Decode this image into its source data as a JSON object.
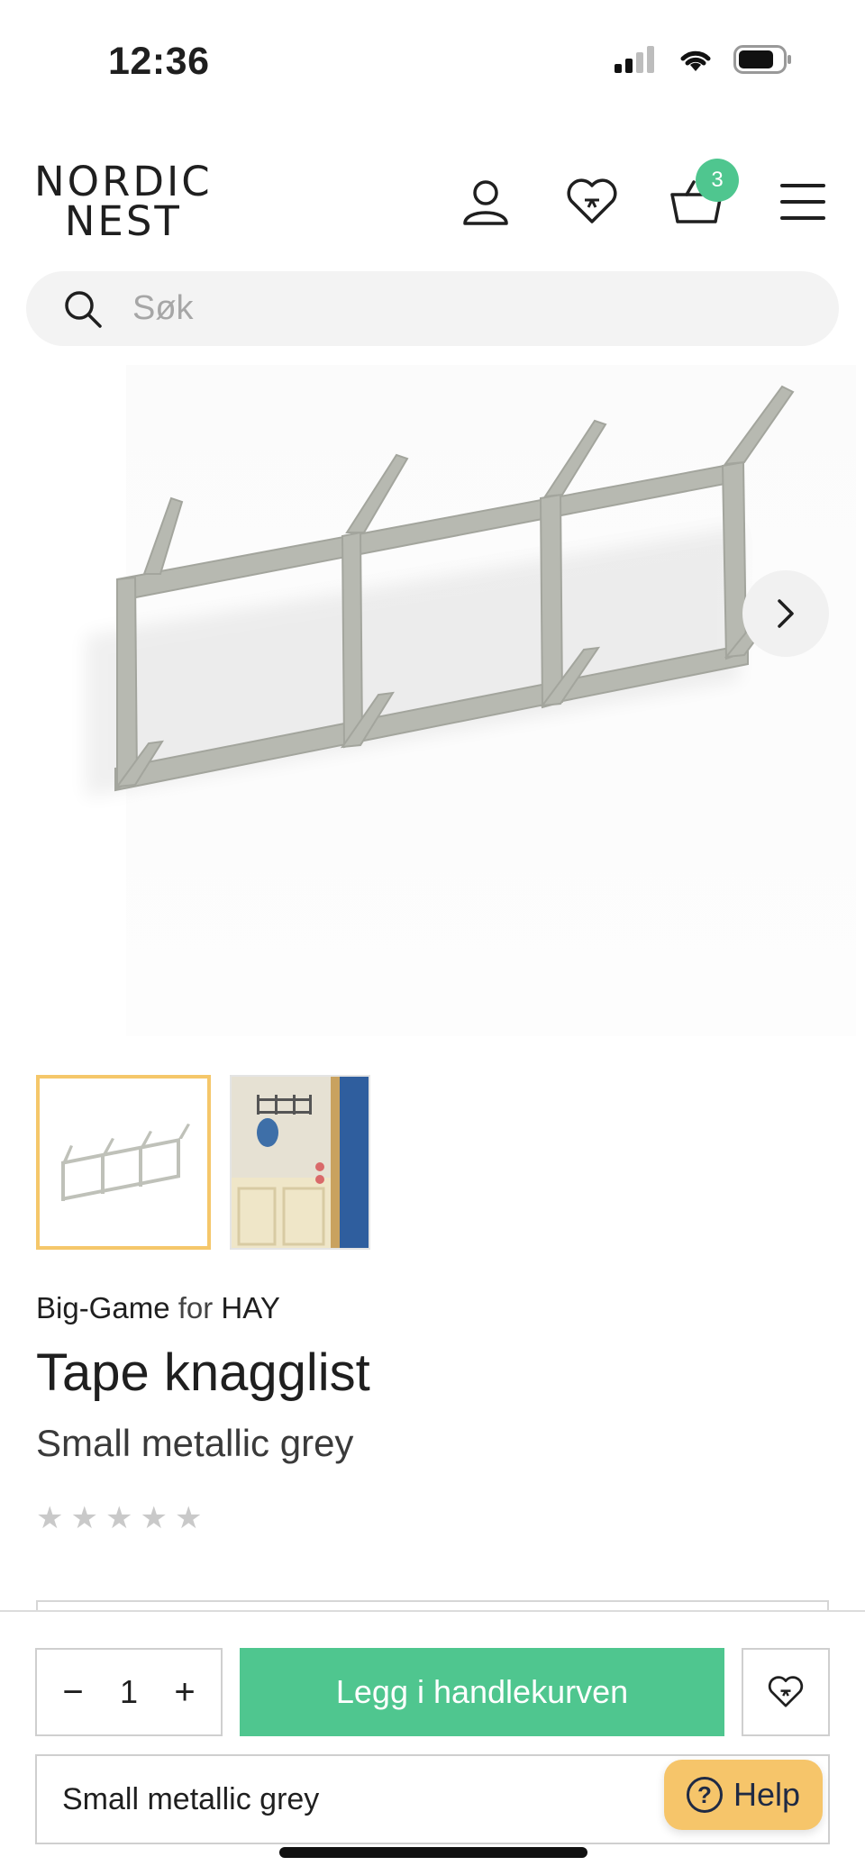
{
  "status_bar": {
    "time": "12:36"
  },
  "header": {
    "logo_line1": "NORDIC",
    "logo_line2": "NEST",
    "cart_count": "3",
    "icons": [
      "user-icon",
      "heart-icon",
      "basket-icon",
      "menu-icon"
    ]
  },
  "search": {
    "placeholder": "Søk"
  },
  "gallery": {
    "thumbnails": 2,
    "selected_index": 0,
    "accent_color": "#f5c76a"
  },
  "product": {
    "designer": "Big-Game",
    "for_word": "for",
    "brand": "HAY",
    "title": "Tape knagglist",
    "variant": "Small metallic grey",
    "rating_stars": 5,
    "rating_value": 0
  },
  "purchase": {
    "qty_minus": "−",
    "qty_value": "1",
    "qty_plus": "+",
    "add_to_cart_label": "Legg i handlekurven",
    "add_to_cart_color": "#4fc68f",
    "selected_variant": "Small metallic grey"
  },
  "help": {
    "label": "Help",
    "icon_glyph": "?",
    "color": "#f6c56a"
  }
}
